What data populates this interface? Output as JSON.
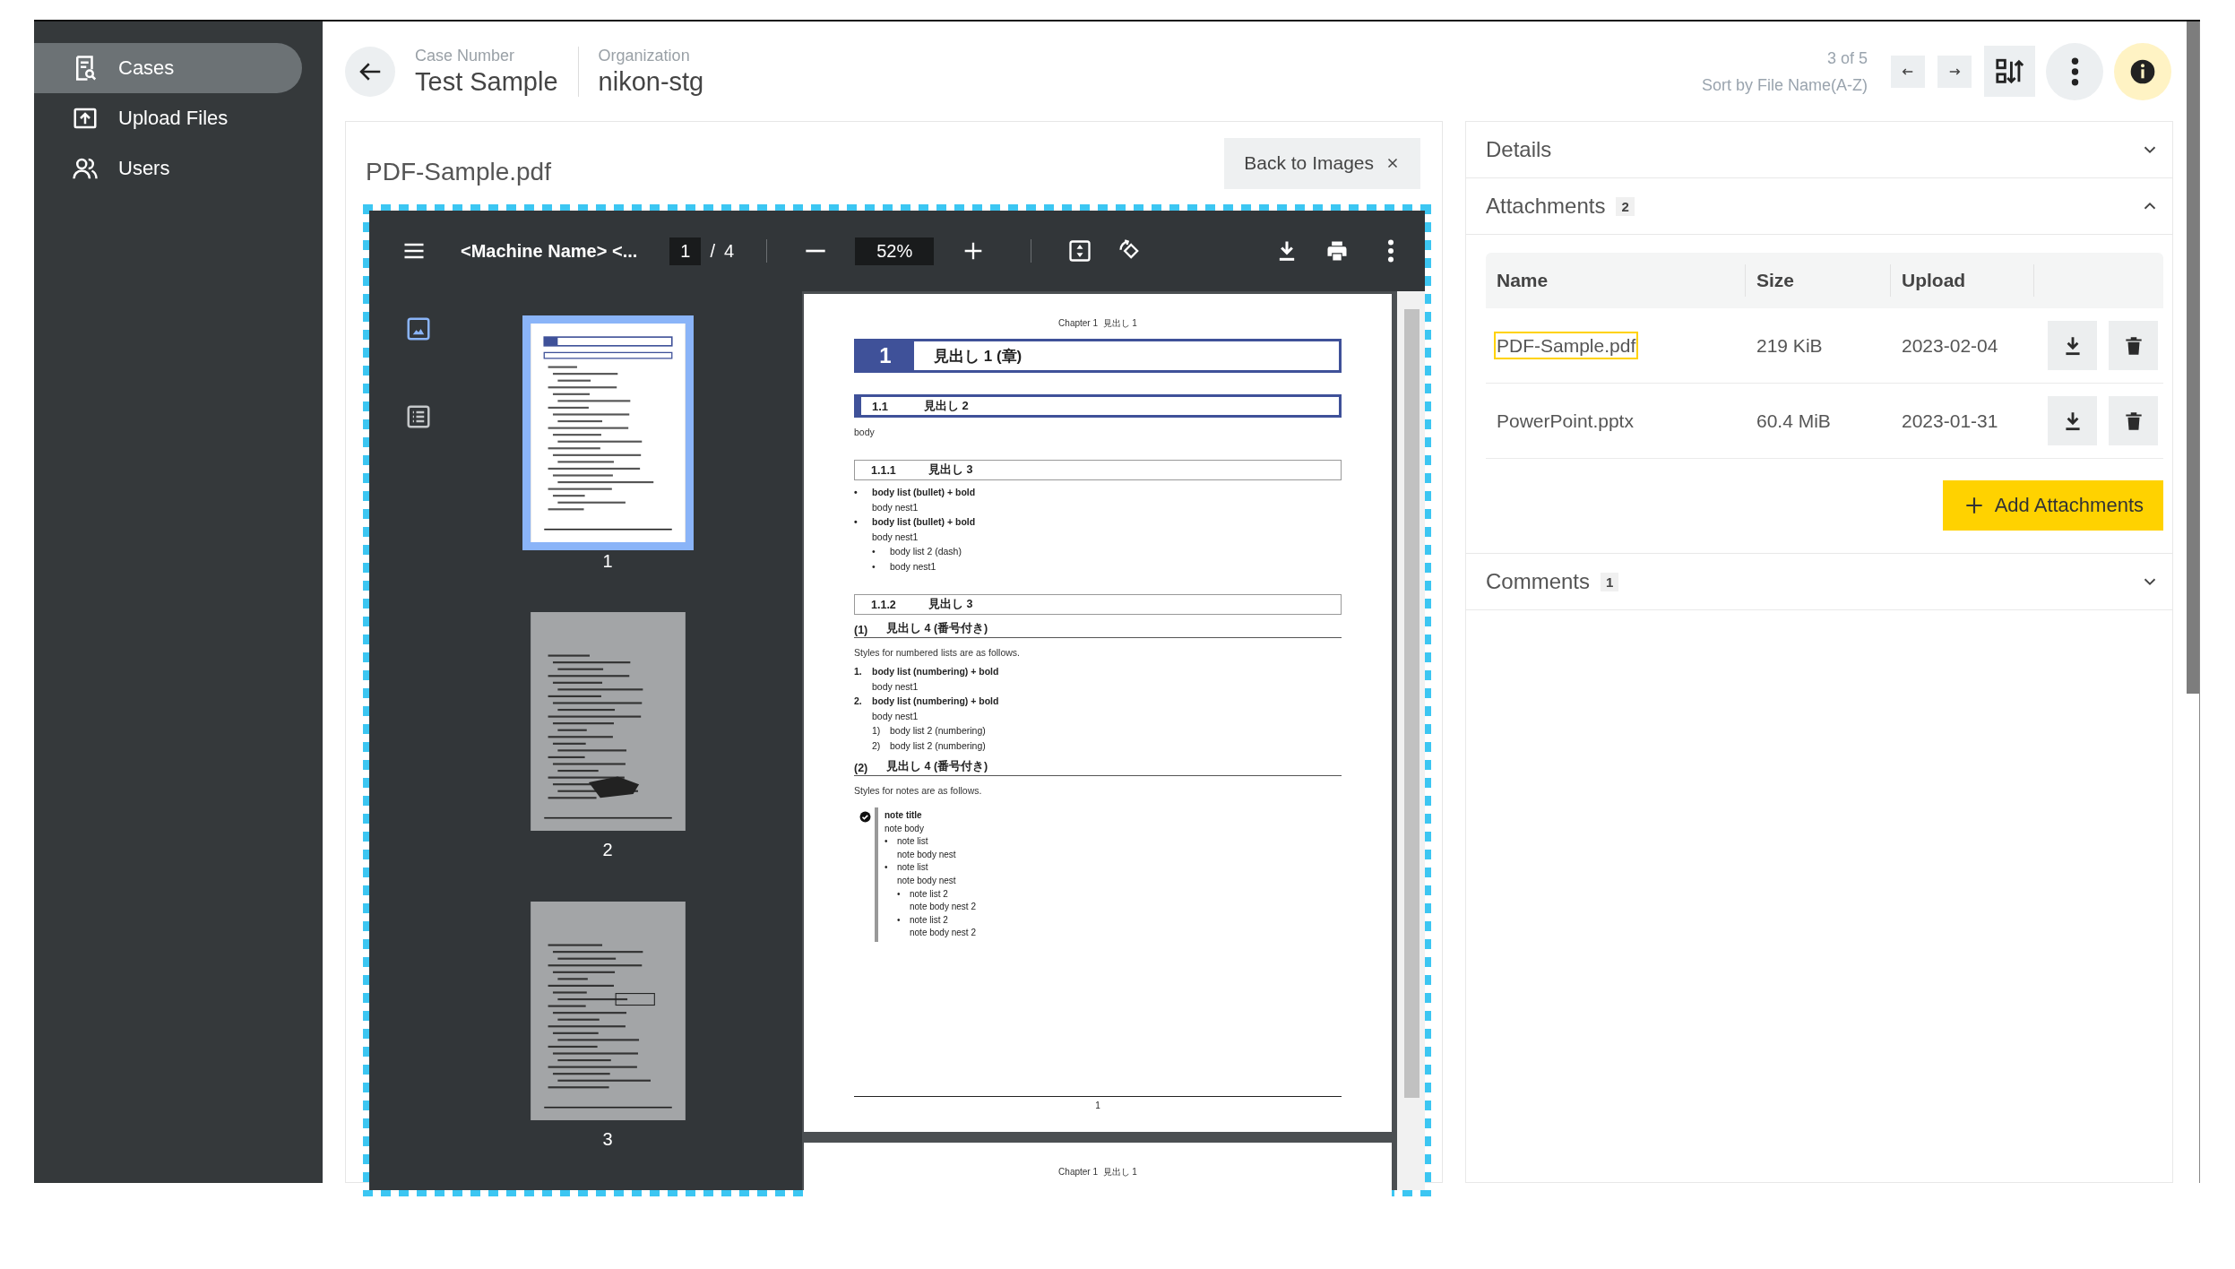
{
  "sidebar": {
    "items": [
      {
        "label": "Cases",
        "selected": true
      },
      {
        "label": "Upload Files",
        "selected": false
      },
      {
        "label": "Users",
        "selected": false
      }
    ]
  },
  "header": {
    "fields": [
      {
        "label": "Case Number",
        "value": "Test Sample"
      },
      {
        "label": "Organization",
        "value": "nikon-stg"
      }
    ],
    "position": "3 of 5",
    "sort_label": "Sort by File Name(A-Z)"
  },
  "file_viewer": {
    "title": "PDF-Sample.pdf",
    "back_button": "Back to Images",
    "pdf_toolbar": {
      "document_title": "<Machine Name> <...",
      "page": "1",
      "page_separator": "/",
      "page_count": "4",
      "zoom": "52%"
    },
    "sidebar_views": [
      {
        "selected": true
      },
      {
        "selected": false
      }
    ],
    "thumbnails": [
      {
        "label": "1",
        "selected": true
      },
      {
        "label": "2",
        "selected": false
      },
      {
        "label": "3",
        "selected": false
      }
    ],
    "pages": [
      {
        "running_header": "Chapter 1  見出し 1",
        "page_number": "1",
        "blocks": [
          {
            "kind": "h1",
            "number": "1",
            "text": "見出し 1 (章)"
          },
          {
            "kind": "h2",
            "number": "1.1",
            "text": "見出し 2"
          },
          {
            "kind": "para",
            "text": "body"
          },
          {
            "kind": "h3",
            "number": "1.1.1",
            "text": "見出し 3"
          },
          {
            "kind": "list",
            "items": [
              {
                "marker": "•",
                "text": "body list (bullet) + bold",
                "bold": true,
                "children": [
                  {
                    "text": "body nest1",
                    "bold": false
                  }
                ]
              },
              {
                "marker": "•",
                "text": "body list (bullet) + bold",
                "bold": true,
                "children": [
                  {
                    "text": "body nest1",
                    "bold": false
                  },
                  {
                    "marker": "•",
                    "text": "body list 2 (dash)",
                    "bold": false
                  },
                  {
                    "marker": "•",
                    "text": "body nest1",
                    "bold": false
                  }
                ]
              }
            ]
          },
          {
            "kind": "h3",
            "number": "1.1.2",
            "text": "見出し 3"
          },
          {
            "kind": "h4",
            "number": "(1)",
            "text": "見出し 4 (番号付き)"
          },
          {
            "kind": "para",
            "text": "Styles for numbered lists are as follows."
          },
          {
            "kind": "list",
            "items": [
              {
                "marker": "1.",
                "text": "body list (numbering) + bold",
                "bold": true,
                "children": [
                  {
                    "text": "body nest1",
                    "bold": false
                  }
                ]
              },
              {
                "marker": "2.",
                "text": "body list (numbering) + bold",
                "bold": true,
                "children": [
                  {
                    "text": "body nest1",
                    "bold": false
                  },
                  {
                    "marker": "1)",
                    "text": "body list 2 (numbering)",
                    "bold": false
                  },
                  {
                    "marker": "2)",
                    "text": "body list 2 (numbering)",
                    "bold": false
                  }
                ]
              }
            ]
          },
          {
            "kind": "h4",
            "number": "(2)",
            "text": "見出し 4 (番号付き)"
          },
          {
            "kind": "para",
            "text": "Styles for notes are as follows."
          },
          {
            "kind": "note",
            "title": "note title",
            "body": "note body",
            "items": [
              {
                "marker": "•",
                "text": "note list",
                "bold": false,
                "children": [
                  {
                    "text": "note body nest",
                    "bold": false
                  }
                ]
              },
              {
                "marker": "•",
                "text": "note list",
                "bold": false,
                "children": [
                  {
                    "text": "note body nest",
                    "bold": false
                  },
                  {
                    "marker": "•",
                    "text": "note list 2",
                    "bold": false,
                    "children": [
                      {
                        "text": "note body nest 2",
                        "bold": false
                      }
                    ]
                  },
                  {
                    "marker": "•",
                    "text": "note list 2",
                    "bold": false,
                    "children": [
                      {
                        "text": "note body nest 2",
                        "bold": false
                      }
                    ]
                  }
                ]
              }
            ]
          }
        ]
      },
      {
        "running_header": "Chapter 1  見出し 1"
      }
    ]
  },
  "details_panel": {
    "sections": [
      {
        "title": "Details",
        "expanded": false
      },
      {
        "title": "Attachments",
        "count": "2",
        "expanded": true,
        "table": {
          "columns": [
            "Name",
            "Size",
            "Upload"
          ],
          "rows": [
            {
              "name": "PDF-Sample.pdf",
              "size": "219 KiB",
              "upload": "2023-02-04",
              "selected": true
            },
            {
              "name": "PowerPoint.pptx",
              "size": "60.4 MiB",
              "upload": "2023-01-31",
              "selected": false
            }
          ],
          "add_button": "Add Attachments"
        }
      },
      {
        "title": "Comments",
        "count": "1",
        "expanded": false
      }
    ]
  }
}
